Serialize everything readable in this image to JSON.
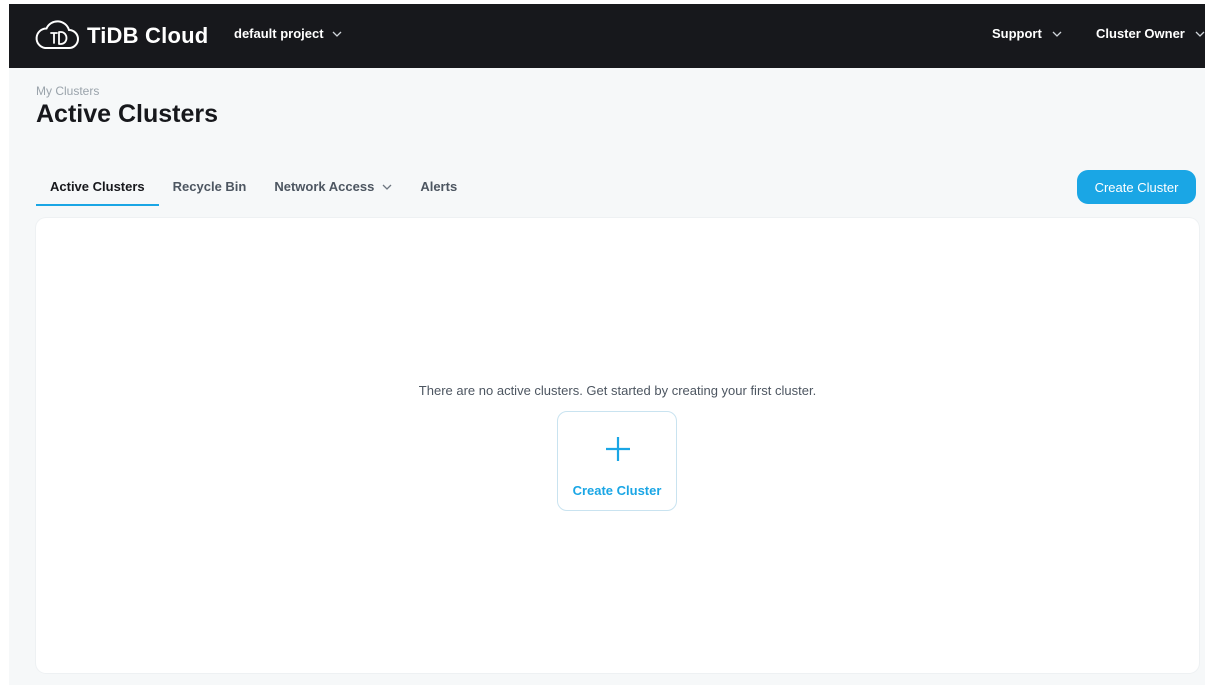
{
  "app": {
    "name": "TiDB Cloud",
    "project_label": "default project",
    "support_label": "Support",
    "role_label": "Cluster Owner"
  },
  "header": {
    "breadcrumb": "My Clusters",
    "title": "Active Clusters"
  },
  "tabs": [
    {
      "label": "Active Clusters",
      "active": true
    },
    {
      "label": "Recycle Bin",
      "active": false
    },
    {
      "label": "Network Access",
      "active": false,
      "has_dropdown": true
    },
    {
      "label": "Alerts",
      "active": false
    }
  ],
  "actions": {
    "create_cluster_label": "Create Cluster"
  },
  "empty_state": {
    "message": "There are no active clusters. Get started by creating your first cluster.",
    "card_label": "Create Cluster",
    "icon": "plus-icon"
  },
  "colors": {
    "topbar": "#17181c",
    "accent": "#1aa6e5",
    "background": "#f6f8f9"
  }
}
